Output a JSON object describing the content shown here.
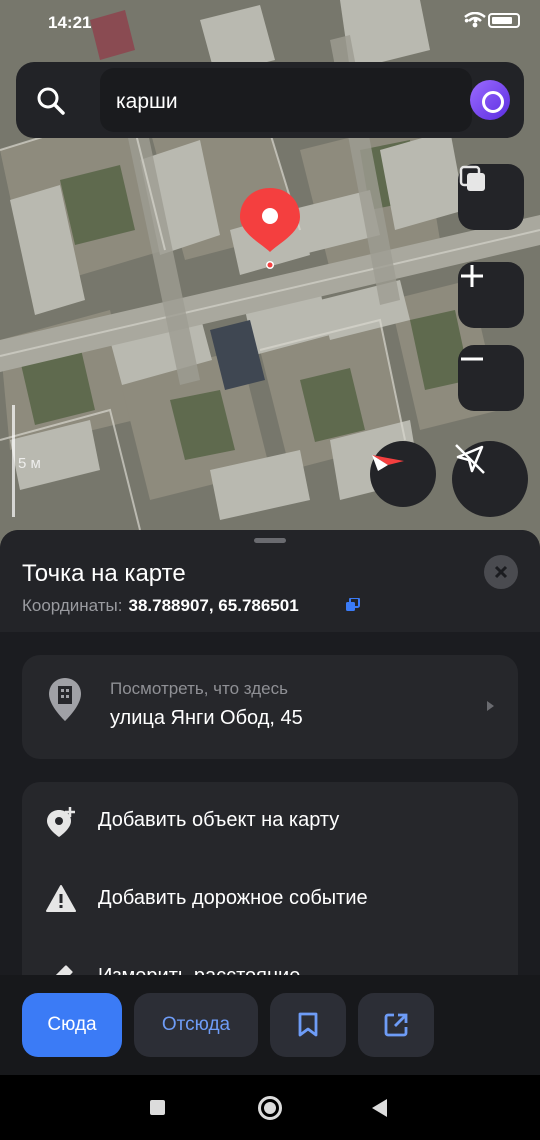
{
  "status_bar": {
    "time": "14:21"
  },
  "search": {
    "query": "карши"
  },
  "map": {
    "scale_label": "5 м"
  },
  "sheet": {
    "title": "Точка на карте",
    "coords_label": "Координаты:",
    "coords_value": "38.788907, 65.786501",
    "whats_here": {
      "subtitle": "Посмотреть, что здесь",
      "address": "улица Янги Обод, 45"
    },
    "actions": [
      {
        "label": "Добавить объект на карту",
        "icon": "add-place-icon"
      },
      {
        "label": "Добавить дорожное событие",
        "icon": "road-event-warning-icon"
      },
      {
        "label": "Измерить расстояние",
        "icon": "ruler-icon"
      }
    ]
  },
  "bottom_bar": {
    "here_label": "Сюда",
    "from_label": "Отсюда"
  },
  "colors": {
    "accent": "#3b7bf6",
    "pin": "#f43f3f",
    "sheet_bg": "#1b1c20",
    "card_bg": "#26272b"
  }
}
